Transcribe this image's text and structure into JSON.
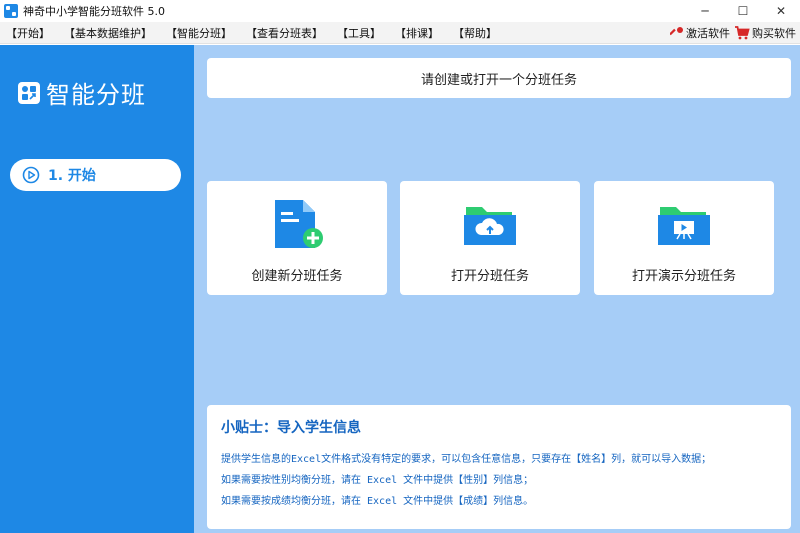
{
  "window": {
    "title": "神奇中小学智能分班软件 5.0",
    "minimize": "─",
    "maximize": "☐",
    "close": "✕"
  },
  "menu": {
    "items": [
      "【开始】",
      "【基本数据维护】",
      "【智能分班】",
      "【查看分班表】",
      "【工具】",
      "【排课】",
      "【帮助】"
    ],
    "activate": "激活软件",
    "buy": "购买软件"
  },
  "sidebar": {
    "brand": "智能分班",
    "nav": [
      {
        "label": "1. 开始"
      }
    ]
  },
  "main": {
    "prompt": "请创建或打开一个分班任务",
    "cards": [
      {
        "label": "创建新分班任务",
        "icon": "new-file-icon"
      },
      {
        "label": "打开分班任务",
        "icon": "cloud-folder-icon"
      },
      {
        "label": "打开演示分班任务",
        "icon": "presentation-folder-icon"
      }
    ],
    "tips": {
      "title": "小贴士：导入学生信息",
      "lines": [
        "提供学生信息的Excel文件格式没有特定的要求，可以包含任意信息，只要存在【姓名】列，就可以导入数据；",
        "如果需要按性别均衡分班，请在 Excel 文件中提供【性别】列信息；",
        "如果需要按成绩均衡分班，请在 Excel 文件中提供【成绩】列信息。"
      ]
    }
  },
  "colors": {
    "primary": "#1e88e5",
    "main_bg": "#a6cdf7",
    "tips_text": "#1565c0",
    "accent_green": "#2ecc71",
    "cart_red": "#d62828"
  }
}
